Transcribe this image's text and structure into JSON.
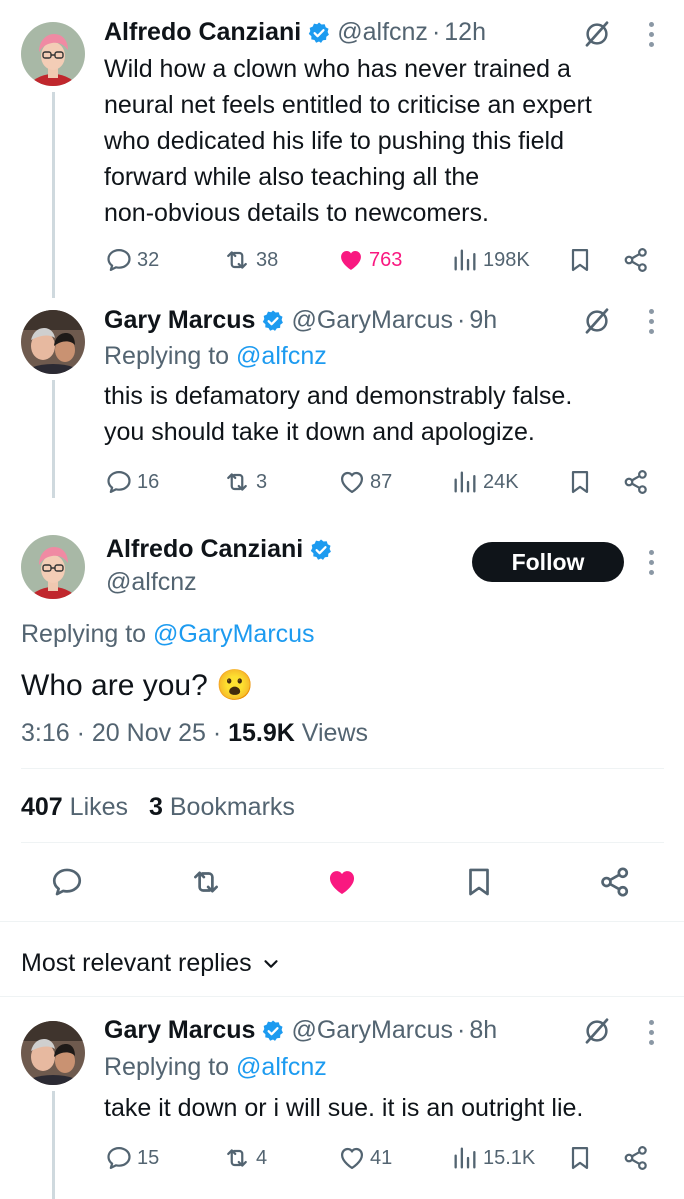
{
  "tweets": [
    {
      "author": "Alfredo Canziani",
      "handle": "@alfcnz",
      "time": "12h",
      "lines": [
        "Wild how a clown who has never trained a",
        "neural net feels entitled to criticise an expert",
        "who dedicated his life to pushing this field",
        "forward while also teaching all the",
        "non-obvious details to newcomers."
      ],
      "replies": "32",
      "reposts": "38",
      "likes": "763",
      "views": "198K",
      "liked": true
    },
    {
      "author": "Gary Marcus",
      "handle": "@GaryMarcus",
      "time": "9h",
      "replying_prefix": "Replying to",
      "replying_to": "@alfcnz",
      "lines": [
        "this is defamatory and demonstrably false.",
        "you should take it down and apologize."
      ],
      "replies": "16",
      "reposts": "3",
      "likes": "87",
      "views": "24K",
      "liked": false
    }
  ],
  "main_tweet": {
    "author": "Alfredo Canziani",
    "handle": "@alfcnz",
    "follow_label": "Follow",
    "replying_prefix": "Replying to",
    "replying_to": "@GaryMarcus",
    "text": "Who are you? 😮",
    "time": "3:16",
    "date": "20 Nov 25",
    "views_count": "15.9K",
    "views_label": "Views",
    "likes_count": "407",
    "likes_label": "Likes",
    "bookmarks_count": "3",
    "bookmarks_label": "Bookmarks"
  },
  "replies_section": {
    "sort_label": "Most relevant replies"
  },
  "reply": {
    "author": "Gary Marcus",
    "handle": "@GaryMarcus",
    "time": "8h",
    "replying_prefix": "Replying to",
    "replying_to": "@alfcnz",
    "text": "take it down or i will sue. it is an outright lie.",
    "replies": "15",
    "reposts": "4",
    "likes": "41",
    "views": "15.1K"
  },
  "colors": {
    "link": "#1d9bf0",
    "like_active": "#f91880",
    "verified": "#1d9bf0",
    "secondary_text": "#536471"
  }
}
